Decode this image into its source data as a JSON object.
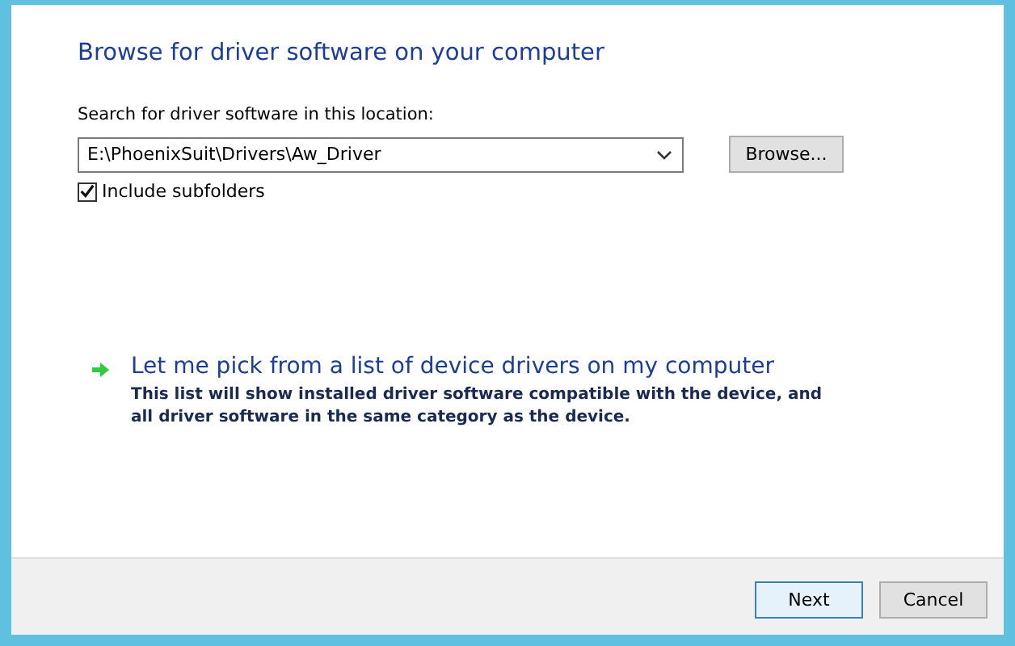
{
  "heading": "Browse for driver software on your computer",
  "search": {
    "label": "Search for driver software in this location:",
    "value": "E:\\PhoenixSuit\\Drivers\\Aw_Driver",
    "browse_button": "Browse..."
  },
  "include_subfolders": {
    "label": "Include subfolders",
    "checked": true
  },
  "pick_option": {
    "title": "Let me pick from a list of device drivers on my computer",
    "description": "This list will show installed driver software compatible with the device, and all driver software in the same category as the device."
  },
  "buttons": [
    {
      "label": "Next",
      "kind": "default"
    },
    {
      "label": "Cancel",
      "kind": "normal"
    }
  ]
}
